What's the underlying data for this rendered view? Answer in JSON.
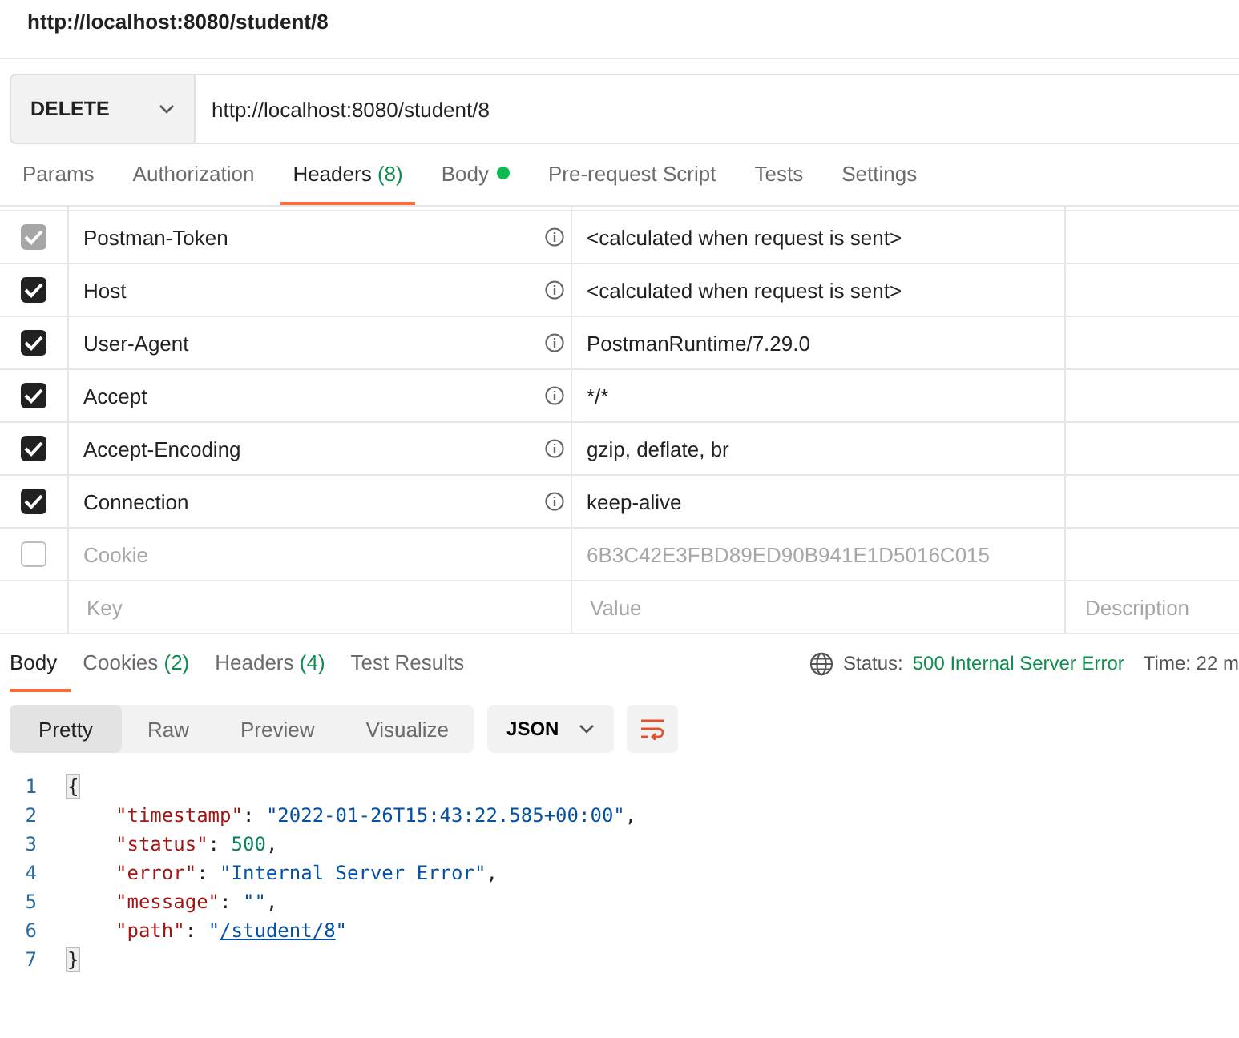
{
  "window": {
    "title": "http://localhost:8080/student/8"
  },
  "request": {
    "method": "DELETE",
    "url": "http://localhost:8080/student/8"
  },
  "request_tabs": [
    {
      "label": "Params",
      "selected": false
    },
    {
      "label": "Authorization",
      "selected": false
    },
    {
      "label": "Headers",
      "count": "(8)",
      "selected": true
    },
    {
      "label": "Body",
      "dot": true,
      "selected": false
    },
    {
      "label": "Pre-request Script",
      "selected": false
    },
    {
      "label": "Tests",
      "selected": false
    },
    {
      "label": "Settings",
      "selected": false
    }
  ],
  "headers": [
    {
      "key": "Postman-Token",
      "value": "<calculated when request is sent>",
      "checked": true,
      "disabled": true,
      "info": true
    },
    {
      "key": "Host",
      "value": "<calculated when request is sent>",
      "checked": true,
      "disabled": false,
      "info": true
    },
    {
      "key": "User-Agent",
      "value": "PostmanRuntime/7.29.0",
      "checked": true,
      "disabled": false,
      "info": true
    },
    {
      "key": "Accept",
      "value": "*/*",
      "checked": true,
      "disabled": false,
      "info": true
    },
    {
      "key": "Accept-Encoding",
      "value": "gzip, deflate, br",
      "checked": true,
      "disabled": false,
      "info": true
    },
    {
      "key": "Connection",
      "value": "keep-alive",
      "checked": true,
      "disabled": false,
      "info": true
    },
    {
      "key": "Cookie",
      "value": "6B3C42E3FBD89ED90B941E1D5016C015",
      "checked": false,
      "disabled": false,
      "info": false
    }
  ],
  "new_header": {
    "key_placeholder": "Key",
    "value_placeholder": "Value",
    "description_placeholder": "Description"
  },
  "response_tabs": [
    {
      "label": "Body",
      "selected": true
    },
    {
      "label": "Cookies",
      "count": "(2)",
      "selected": false
    },
    {
      "label": "Headers",
      "count": "(4)",
      "selected": false
    },
    {
      "label": "Test Results",
      "selected": false
    }
  ],
  "status": {
    "label": "Status:",
    "value": "500 Internal Server Error",
    "time_label": "Time: 22 m"
  },
  "view_modes": [
    {
      "label": "Pretty",
      "selected": true
    },
    {
      "label": "Raw",
      "selected": false
    },
    {
      "label": "Preview",
      "selected": false
    },
    {
      "label": "Visualize",
      "selected": false
    }
  ],
  "format": "JSON",
  "code": [
    {
      "number": "1",
      "tokens": [
        {
          "kind": "brace",
          "text": "{"
        }
      ]
    },
    {
      "number": "2",
      "tokens": [
        {
          "kind": "key",
          "text": "\"timestamp\""
        },
        {
          "kind": "punct",
          "text": ": "
        },
        {
          "kind": "string",
          "text": "\"2022-01-26T15:43:22.585+00:00\""
        },
        {
          "kind": "punct",
          "text": ","
        }
      ]
    },
    {
      "number": "3",
      "tokens": [
        {
          "kind": "key",
          "text": "\"status\""
        },
        {
          "kind": "punct",
          "text": ": "
        },
        {
          "kind": "number",
          "text": "500"
        },
        {
          "kind": "punct",
          "text": ","
        }
      ]
    },
    {
      "number": "4",
      "tokens": [
        {
          "kind": "key",
          "text": "\"error\""
        },
        {
          "kind": "punct",
          "text": ": "
        },
        {
          "kind": "string",
          "text": "\"Internal Server Error\""
        },
        {
          "kind": "punct",
          "text": ","
        }
      ]
    },
    {
      "number": "5",
      "tokens": [
        {
          "kind": "key",
          "text": "\"message\""
        },
        {
          "kind": "punct",
          "text": ": "
        },
        {
          "kind": "string",
          "text": "\"\""
        },
        {
          "kind": "punct",
          "text": ","
        }
      ]
    },
    {
      "number": "6",
      "tokens": [
        {
          "kind": "key",
          "text": "\"path\""
        },
        {
          "kind": "punct",
          "text": ": "
        },
        {
          "kind": "string",
          "text": "\""
        },
        {
          "kind": "link",
          "text": "/student/8"
        },
        {
          "kind": "string",
          "text": "\""
        }
      ]
    },
    {
      "number": "7",
      "tokens": [
        {
          "kind": "brace",
          "text": "}"
        }
      ]
    }
  ]
}
